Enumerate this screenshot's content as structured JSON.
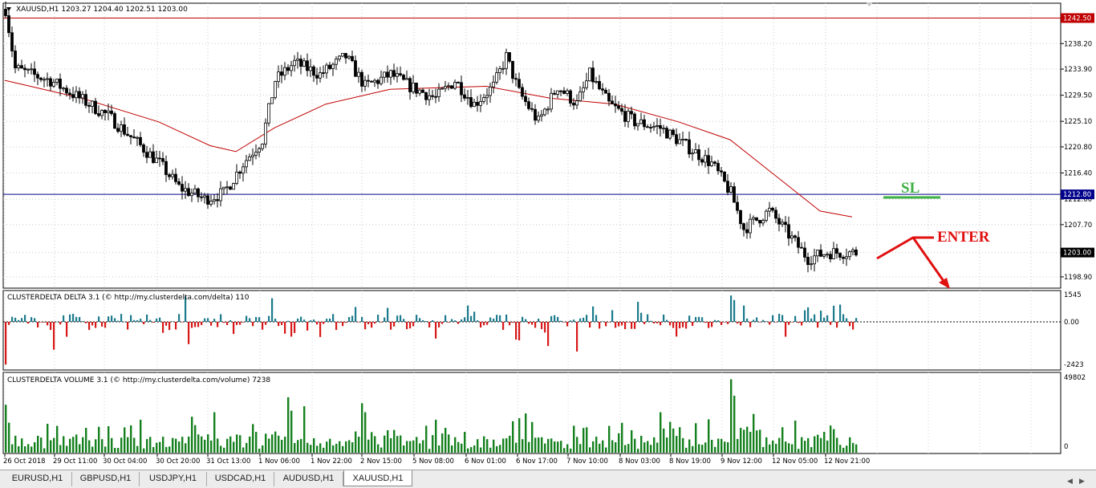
{
  "main_chart": {
    "header": "XAUUSD,H1  1203.27 1204.40 1202.51 1203.00",
    "price_labels": [
      "1238.20",
      "1233.90",
      "1229.50",
      "1225.10",
      "1220.80",
      "1216.40",
      "1212.00",
      "1207.70",
      "1203.00",
      "1198.90"
    ],
    "hline_red_label": "1242.50",
    "hline_blue_label": "1212.80",
    "current_price_label": "1203.00",
    "annotations": {
      "sl": "SL",
      "enter": "ENTER"
    },
    "colors": {
      "bull": "#000000",
      "ma": "#c00000",
      "red_line": "#c00000",
      "blue_line": "#00008b",
      "sl": "#3cb043",
      "enter": "#e01010"
    }
  },
  "delta_panel": {
    "title": "CLUSTERDELTA DELTA 3.1 (© http://my.clusterdelta.com/delta) 110",
    "labels": [
      "1545",
      "0.00",
      "-2423"
    ]
  },
  "volume_panel": {
    "title": "CLUSTERDELTA VOLUME 3.1 (© http://my.clusterdelta.com/volume) 7238",
    "labels": [
      "49802",
      "0"
    ]
  },
  "time_labels": [
    "26 Oct 2018",
    "29 Oct 11:00",
    "30 Oct 04:00",
    "30 Oct 20:00",
    "31 Oct 13:00",
    "1 Nov 06:00",
    "1 Nov 22:00",
    "2 Nov 15:00",
    "5 Nov 08:00",
    "6 Nov 01:00",
    "6 Nov 17:00",
    "7 Nov 10:00",
    "8 Nov 03:00",
    "8 Nov 19:00",
    "9 Nov 12:00",
    "12 Nov 05:00",
    "12 Nov 21:00"
  ],
  "tabs": [
    {
      "label": "EURUSD,H1",
      "active": false
    },
    {
      "label": "GBPUSD,H1",
      "active": false
    },
    {
      "label": "USDJPY,H1",
      "active": false
    },
    {
      "label": "USDCAD,H1",
      "active": false
    },
    {
      "label": "AUDUSD,H1",
      "active": false
    },
    {
      "label": "XAUUSD,H1",
      "active": true
    }
  ],
  "chart_data": {
    "type": "candlestick",
    "symbol": "XAUUSD",
    "timeframe": "H1",
    "ylim": [
      1197,
      1245
    ],
    "close_path": [
      [
        0,
        1244
      ],
      [
        3,
        1234
      ],
      [
        8,
        1233
      ],
      [
        14,
        1232
      ],
      [
        20,
        1230
      ],
      [
        26,
        1228
      ],
      [
        32,
        1226
      ],
      [
        40,
        1222
      ],
      [
        48,
        1218
      ],
      [
        54,
        1214
      ],
      [
        62,
        1212
      ],
      [
        68,
        1213
      ],
      [
        74,
        1218
      ],
      [
        80,
        1222
      ],
      [
        84,
        1232
      ],
      [
        90,
        1235
      ],
      [
        98,
        1233
      ],
      [
        106,
        1236
      ],
      [
        112,
        1231
      ],
      [
        120,
        1233
      ],
      [
        126,
        1231
      ],
      [
        134,
        1229
      ],
      [
        140,
        1232
      ],
      [
        146,
        1228
      ],
      [
        152,
        1231
      ],
      [
        156,
        1236
      ],
      [
        160,
        1230
      ],
      [
        166,
        1225
      ],
      [
        172,
        1231
      ],
      [
        178,
        1228
      ],
      [
        182,
        1233
      ],
      [
        188,
        1228
      ],
      [
        196,
        1225
      ],
      [
        204,
        1224
      ],
      [
        212,
        1221
      ],
      [
        220,
        1218
      ],
      [
        226,
        1213
      ],
      [
        230,
        1207
      ],
      [
        238,
        1210
      ],
      [
        244,
        1206
      ],
      [
        250,
        1202
      ],
      [
        256,
        1203
      ],
      [
        264,
        1203
      ]
    ],
    "moving_average": [
      [
        0,
        1232
      ],
      [
        24,
        1229
      ],
      [
        48,
        1225
      ],
      [
        64,
        1221
      ],
      [
        72,
        1220
      ],
      [
        84,
        1224
      ],
      [
        100,
        1228
      ],
      [
        120,
        1230.5
      ],
      [
        150,
        1231
      ],
      [
        170,
        1229
      ],
      [
        190,
        1228
      ],
      [
        210,
        1225
      ],
      [
        226,
        1222
      ],
      [
        240,
        1216
      ],
      [
        254,
        1210
      ],
      [
        264,
        1209
      ]
    ],
    "horizontal_lines": [
      {
        "price": 1242.5,
        "color": "#c00000"
      },
      {
        "price": 1212.8,
        "color": "#00008b"
      }
    ],
    "delta_ylim": [
      -2423,
      1545
    ],
    "volume_ylim": [
      0,
      49802
    ],
    "bar_count": 266
  }
}
